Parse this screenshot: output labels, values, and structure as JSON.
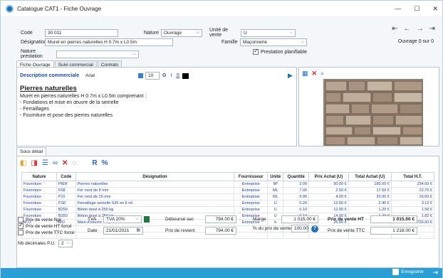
{
  "window": {
    "title": "Catalogue CAT1 - Fiche Ouvrage",
    "min": "—",
    "max": "☐",
    "close": "✕"
  },
  "form": {
    "code_label": "Code",
    "code_value": "30 011",
    "nature_label": "Nature",
    "nature_value": "Ouvrage",
    "unite_label": "Unité de vente",
    "unite_value": "U",
    "designation_label": "Désignation",
    "designation_value": "Muret en pierres naturelles H 0.7m x L0.5m",
    "famille_label": "Famille",
    "famille_value": "Maçonnerie",
    "nature_prest_label": "Nature prestation",
    "nature_prest_value": "",
    "planifiable_label": "Prestation planifiable",
    "ouvrage_count": "Ouvrage 0 sur 0"
  },
  "nav": {
    "first": "⇤",
    "prev": "←",
    "next": "→",
    "last": "⇥"
  },
  "tabs": [
    "Fiche Ouvrage",
    "Suivi commercial",
    "Contrats"
  ],
  "editor": {
    "title": "Description commerciale",
    "font": "Arial",
    "size": "10",
    "bold": "G",
    "italic": "I",
    "underline": "S",
    "heading": "Pierres naturelles",
    "lines": [
      "Muret en pierres naturelles H 0.7m x L0.5m comprenant :",
      "- Fondations et mise en œuvre de la semelle",
      "- Ferraillages",
      "- Fourniture et pose des pierres naturelles"
    ]
  },
  "subtab": "Sous détail",
  "table": {
    "tool_r": "R",
    "tool_pct": "%",
    "headers": [
      "Nature",
      "Code",
      "Désignation",
      "Fournisseur",
      "Unité",
      "Quantité",
      "Prix Achat (U)",
      "Total Achat (U)",
      "Total H.T."
    ],
    "rows": [
      [
        "Fourniture",
        "PIER",
        "Pierres naturelles",
        "Entreprise",
        "M²",
        "2.00",
        "90.00 €",
        "180.00 €",
        "234.00 €"
      ],
      [
        "Fourniture",
        "F08",
        "Fer rond de 8 mm",
        "Entreprise",
        "ML",
        "7.00",
        "2.50 €",
        "17.50 €",
        "22.75 €"
      ],
      [
        "Fourniture",
        "F10",
        "Fer rond de 10 mm",
        "Entreprise",
        "ML",
        "5.00",
        "4.00 €",
        "20.00 €",
        "26.00 €"
      ],
      [
        "Fourniture",
        "FS6",
        "Ferraillage semelle S35 en 6 ml",
        "Entreprise",
        "U",
        "0.20",
        "12.00 €",
        "2.40 €",
        "3.12 €"
      ],
      [
        "Fourniture",
        "B250",
        "Béton dosé à 250 kg",
        "Entreprise",
        "U",
        "0.10",
        "12.00 €",
        "1.20 €",
        "1.56 €"
      ],
      [
        "Fourniture",
        "B350",
        "Béton dosé à 350 kg",
        "Entreprise",
        "U",
        "0.10",
        "14.00 €",
        "1.40 €",
        "1.82 €"
      ],
      [
        "M.O.",
        "MO",
        "Main d'oeuvre moyenne",
        "Entreprise",
        "h",
        "22.000",
        "26.00 €",
        "572.00 €",
        "726.00 €"
      ]
    ]
  },
  "footer": {
    "prix_fige": "Prix de vente figé",
    "prix_ht_force": "Prix de vente HT forcé",
    "prix_ttc_force": "Prix de vente TTC forcé",
    "nb_dec_label": "Nb décimales P.U.",
    "nb_dec_value": "2",
    "tva_label": "TVA",
    "tva_value": "TVA 20%",
    "date_label": "Date",
    "date_value": "21/01/2021",
    "debourse_label": "Déboursé sec",
    "debourse_value": "794.00 €",
    "revient_label": "Prix de revient",
    "revient_value": "794.00 €",
    "marge_label": "Marge",
    "marge_value": "1 015.00 €",
    "pct_label": "% du prix de vente",
    "pct_value": "100.00",
    "pv_ht_label": "Prix de vente HT",
    "pv_ht_value": "1 015.00 €",
    "pv_ttc_label": "Prix de vente TTC",
    "pv_ttc_value": "1 218.00 €"
  },
  "bottom": {
    "save_label": "Enregistrer"
  }
}
